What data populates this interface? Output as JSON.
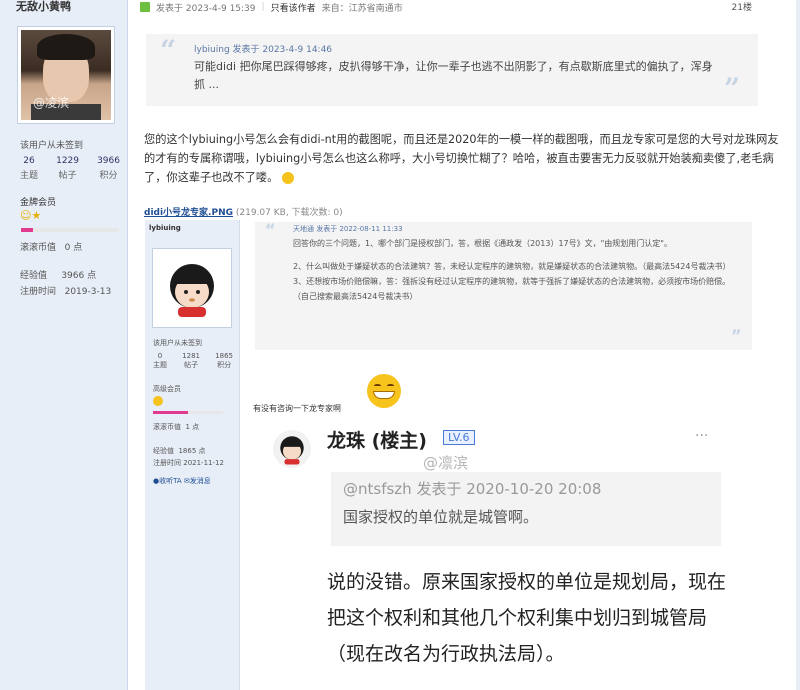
{
  "sidebar": {
    "username": "无敌小黄鸭",
    "avatar_watermark": "@凌滨",
    "signed": "该用户从未签到",
    "stats": [
      {
        "value": "26",
        "label": "主题"
      },
      {
        "value": "1229",
        "label": "帖子"
      },
      {
        "value": "3966",
        "label": "积分"
      }
    ],
    "rank": "金牌会员",
    "rank_progress": 0.12,
    "coins": "滚滚币值",
    "coins_value": "0 点",
    "exp_label": "经验值",
    "exp_value": "3966 点",
    "reg_label": "注册时间",
    "reg_value": "2019-3-13"
  },
  "header": {
    "posted": "发表于 2023-4-9 15:39",
    "only_author": "只看该作者",
    "source": "来自：江苏省南通市",
    "floor": "21楼"
  },
  "quote": {
    "author_line": "lybiuing 发表于 2023-4-9 14:46",
    "text": "可能didi 把你尾巴踩得够疼，皮扒得够干净，让你一辈子也逃不出阴影了，有点歇斯底里式的偏执了，浑身抓 ..."
  },
  "main_text": "您的这个lybiuing小号怎么会有didi-nt用的截图呢，而且还是2020年的一模一样的截图哦，而且龙专家可是您的大号对龙珠网友的才有的专属称谓哦，lybiuing小号怎么也这么称呼，大小号切换忙糊了？哈哈，被直击要害无力反驳就开始装痴卖傻了,老毛病了，你这辈子也改不了喽。",
  "attachment": {
    "name": "didi小号龙专家.PNG",
    "meta": "(219.07 KB, 下载次数: 0)"
  },
  "embed": {
    "username": "lybiuing",
    "signed": "该用户从未签到",
    "stats": [
      {
        "value": "0",
        "label": "主题"
      },
      {
        "value": "1281",
        "label": "帖子"
      },
      {
        "value": "1865",
        "label": "积分"
      }
    ],
    "rank": "高级会员",
    "coins": "滚滚币值",
    "coins_value": "1 点",
    "exp": "经验值",
    "exp_value": "1865 点",
    "reg": "注册时间",
    "reg_value": "2021-11-12",
    "fav": "收听TA",
    "msg": "发消息",
    "quote_head": "天地通 发表于 2022-08-11 11:33",
    "quote_lines": [
      "回答你的三个问题，1、哪个部门是授权部门，答，根据《通政发（2013）17号》文，\"由规划用门认定\"。",
      "2、什么叫做处于嫌疑状态的合法建筑？答，未经认定程序的建筑物，就是嫌疑状态的合法建筑物。（最高法5424号裁决书）",
      "3、还想按市场价赔偿嘛，答：强拆没有经过认定程序的建筑物，就等于强拆了嫌疑状态的合法建筑物，必须按市场价赔偿。（自己搜索最高法5424号裁决书）"
    ],
    "under_text": "有没有咨询一下龙专家啊",
    "phone_name": "龙珠 (楼主)",
    "phone_level": "LV.6",
    "phone_watermark": "@凛滨",
    "phone_quote_head": "@ntsfszh 发表于 2020-10-20 20:08",
    "phone_quote_body": "国家授权的单位就是城管啊。",
    "phone_body": "说的没错。原来国家授权的单位是规划局，现在把这个权利和其他几个权利集中划归到城管局（现在改名为行政执法局）。"
  }
}
